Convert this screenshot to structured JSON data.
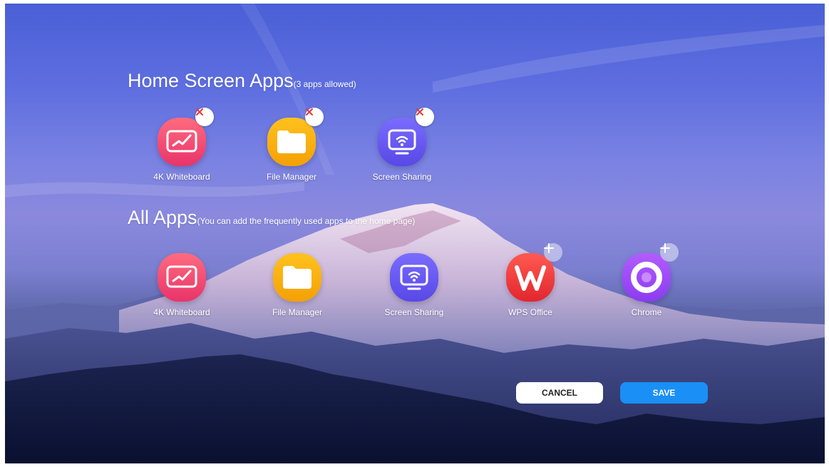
{
  "home": {
    "title": "Home Screen Apps",
    "subtitle": "(3 apps allowed)",
    "apps": [
      {
        "label": "4K Whiteboard",
        "icon": "whiteboard-icon",
        "color_top": "#ff6b7f",
        "color_bottom": "#e8346a",
        "action": "remove"
      },
      {
        "label": "File Manager",
        "icon": "folder-icon",
        "color_top": "#ffc21f",
        "color_bottom": "#f4a004",
        "action": "remove"
      },
      {
        "label": "Screen Sharing",
        "icon": "screen-share-icon",
        "color_top": "#7b6cff",
        "color_bottom": "#5848e6",
        "action": "remove"
      }
    ]
  },
  "all": {
    "title": "All Apps",
    "subtitle": "(You can add the frequently used apps to the home page)",
    "apps": [
      {
        "label": "4K Whiteboard",
        "icon": "whiteboard-icon",
        "color_top": "#ff6b7f",
        "color_bottom": "#e8346a",
        "action": "none"
      },
      {
        "label": "File Manager",
        "icon": "folder-icon",
        "color_top": "#ffc21f",
        "color_bottom": "#f4a004",
        "action": "none"
      },
      {
        "label": "Screen Sharing",
        "icon": "screen-share-icon",
        "color_top": "#7b6cff",
        "color_bottom": "#5848e6",
        "action": "none"
      },
      {
        "label": "WPS Office",
        "icon": "wps-icon",
        "color_top": "#ff5a52",
        "color_bottom": "#e2262e",
        "action": "add"
      },
      {
        "label": "Chrome",
        "icon": "chrome-icon",
        "color_top": "#b25cff",
        "color_bottom": "#8a3cf0",
        "action": "add"
      }
    ]
  },
  "actions": {
    "cancel": "CANCEL",
    "save": "SAVE"
  },
  "colors": {
    "save_button": "#1a8ff5",
    "remove_badge_x": "#e53935"
  }
}
